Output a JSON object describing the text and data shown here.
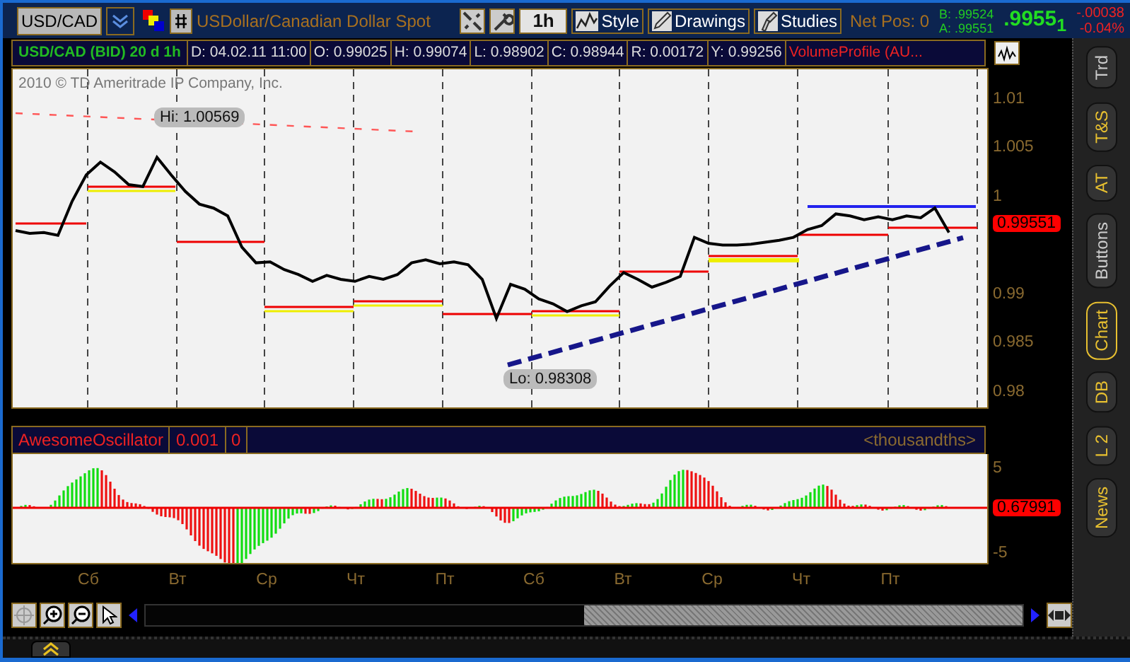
{
  "symbol": {
    "value": "USD/CAD"
  },
  "description": "USDollar/Canadian Dollar Spot",
  "toolbar": {
    "interval": "1h",
    "buttons": [
      "Style",
      "Drawings",
      "Studies"
    ]
  },
  "net_position": "Net Pos: 0",
  "quote": {
    "bid": "B: .99524",
    "ask": "A: .99551",
    "last": ".9955$_{1}$",
    "change": "-.00038",
    "change_percent": "-0.04%"
  },
  "info": [
    {
      "kind": "title",
      "text": "USD/CAD (BID) 20 d 1h"
    },
    {
      "kind": "value",
      "text": "D: 04.02.11 11:00"
    },
    {
      "kind": "value",
      "text": "O: 0.99025"
    },
    {
      "kind": "value",
      "text": "H: 0.99074"
    },
    {
      "kind": "value",
      "text": "L: 0.98902"
    },
    {
      "kind": "value",
      "text": "C: 0.98944"
    },
    {
      "kind": "value",
      "text": "R: 0.00172"
    },
    {
      "kind": "value",
      "text": "Y: 0.99256"
    },
    {
      "kind": "study",
      "text": "VolumeProfile (AU..."
    }
  ],
  "price_chart": {
    "copyright": "2010 © TD Ameritrade IP Company, Inc.",
    "high_label": "Hi: 1.00569",
    "low_label": "Lo: 0.98308",
    "current_price": "0.99551",
    "chart_data": {
      "type": "line",
      "ylim": [
        0.9784,
        1.013
      ],
      "categories": [
        null,
        null,
        null,
        null,
        null,
        null,
        null,
        null,
        null,
        null,
        null,
        null,
        null,
        null,
        null,
        null,
        null,
        null,
        null,
        null,
        null,
        null,
        null,
        null,
        null,
        null,
        null,
        null,
        null,
        null,
        null,
        null,
        null,
        null,
        null,
        null,
        null,
        null,
        null,
        null,
        null,
        null,
        null,
        null,
        null,
        null,
        null,
        null,
        null,
        null,
        null,
        null,
        null,
        null,
        null,
        null,
        null,
        null,
        null,
        null,
        null,
        null,
        null,
        null,
        null,
        null,
        null
      ],
      "yticks": [
        1.01,
        1.005,
        1,
        0.99,
        0.985,
        0.98
      ],
      "series": [
        {
          "color": "#000000",
          "values": [
            0.9965,
            0.9962,
            0.9963,
            0.996,
            0.9995,
            1.0022,
            1.0035,
            1.0025,
            1.0012,
            1.001,
            1.004,
            1.0022,
            1.0005,
            0.9992,
            0.9988,
            0.998,
            0.9948,
            0.9932,
            0.9933,
            0.9925,
            0.992,
            0.9913,
            0.9919,
            0.9915,
            0.9913,
            0.9918,
            0.9915,
            0.992,
            0.9932,
            0.9935,
            0.9931,
            0.9933,
            0.993,
            0.9915,
            0.9875,
            0.991,
            0.9905,
            0.9895,
            0.989,
            0.9882,
            0.9888,
            0.9892,
            0.9908,
            0.9922,
            0.9915,
            0.9907,
            0.9912,
            0.9918,
            0.9958,
            0.9952,
            0.995,
            0.995,
            0.9951,
            0.9953,
            0.9955,
            0.9958,
            0.9966,
            0.997,
            0.9982,
            0.998,
            0.9976,
            0.9979,
            0.9976,
            0.998,
            0.9978,
            0.9988,
            0.9963
          ]
        }
      ]
    }
  },
  "oscillator": {
    "name": "AwesomeOscillator",
    "fields": [
      "0.001",
      "0"
    ],
    "units": "<thousandths>",
    "axis_labels": [
      "5",
      "-5"
    ],
    "current_value": "0.67991"
  },
  "days": [
    "Сб",
    "Вт",
    "Ср",
    "Чт",
    "Пт",
    "Сб",
    "Вт",
    "Ср",
    "Чт",
    "Пт"
  ],
  "side_tabs": [
    {
      "label": "Trd",
      "dimmed": true,
      "selected": false
    },
    {
      "label": "T&S",
      "dimmed": false,
      "selected": false
    },
    {
      "label": "AT",
      "dimmed": false,
      "selected": false
    },
    {
      "label": "Buttons",
      "dimmed": true,
      "selected": false
    },
    {
      "label": "Chart",
      "dimmed": false,
      "selected": true
    },
    {
      "label": "DB",
      "dimmed": false,
      "selected": false
    },
    {
      "label": "L 2",
      "dimmed": false,
      "selected": false
    },
    {
      "label": "News",
      "dimmed": false,
      "selected": false
    }
  ]
}
